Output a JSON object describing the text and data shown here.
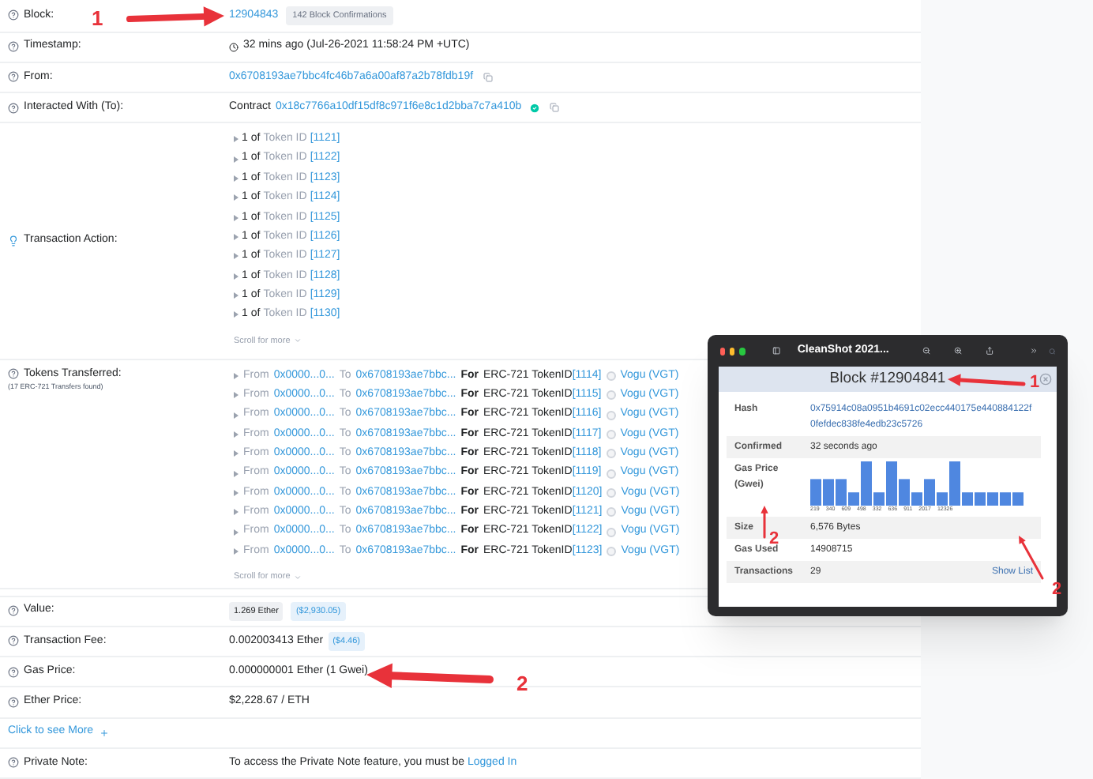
{
  "block": {
    "label": "Block:",
    "value": "12904843",
    "badge": "142 Block Confirmations"
  },
  "timestamp": {
    "label": "Timestamp:",
    "value": "32 mins ago (Jul-26-2021 11:58:24 PM +UTC)"
  },
  "from": {
    "label": "From:",
    "value": "0x6708193ae7bbc4fc46b7a6a00af87a2b78fdb19f"
  },
  "interacted_with": {
    "label": "Interacted With (To):",
    "prefix": "Contract",
    "value": "0x18c7766a10df15df8c971f6e8c1d2bba7c7a410b",
    "verified": true
  },
  "transaction_action": {
    "label": "Transaction Action:",
    "items": [
      {
        "text": "1 of",
        "token": "Token ID",
        "id": "[1121]"
      },
      {
        "text": "1 of",
        "token": "Token ID",
        "id": "[1122]"
      },
      {
        "text": "1 of",
        "token": "Token ID",
        "id": "[1123]"
      },
      {
        "text": "1 of",
        "token": "Token ID",
        "id": "[1124]"
      },
      {
        "text": "1 of",
        "token": "Token ID",
        "id": "[1125]"
      },
      {
        "text": "1 of",
        "token": "Token ID",
        "id": "[1126]"
      },
      {
        "text": "1 of",
        "token": "Token ID",
        "id": "[1127]"
      },
      {
        "text": "1 of",
        "token": "Token ID",
        "id": "[1128]"
      },
      {
        "text": "1 of",
        "token": "Token ID",
        "id": "[1129]"
      },
      {
        "text": "1 of",
        "token": "Token ID",
        "id": "[1130]"
      }
    ],
    "scroll_hint": "Scroll for more"
  },
  "tokens_transferred": {
    "label": "Tokens Transferred:",
    "sublabel": "(17 ERC-721 Transfers found)",
    "items": [
      {
        "from_label": "From",
        "from": "0x0000...0...",
        "to_label": "To",
        "to": "0x6708193ae7bbc...",
        "for_label": "For",
        "standard": "ERC-721 TokenID",
        "id": "[1114]",
        "token": "Vogu (VGT)"
      },
      {
        "from_label": "From",
        "from": "0x0000...0...",
        "to_label": "To",
        "to": "0x6708193ae7bbc...",
        "for_label": "For",
        "standard": "ERC-721 TokenID",
        "id": "[1115]",
        "token": "Vogu (VGT)"
      },
      {
        "from_label": "From",
        "from": "0x0000...0...",
        "to_label": "To",
        "to": "0x6708193ae7bbc...",
        "for_label": "For",
        "standard": "ERC-721 TokenID",
        "id": "[1116]",
        "token": "Vogu (VGT)"
      },
      {
        "from_label": "From",
        "from": "0x0000...0...",
        "to_label": "To",
        "to": "0x6708193ae7bbc...",
        "for_label": "For",
        "standard": "ERC-721 TokenID",
        "id": "[1117]",
        "token": "Vogu (VGT)"
      },
      {
        "from_label": "From",
        "from": "0x0000...0...",
        "to_label": "To",
        "to": "0x6708193ae7bbc...",
        "for_label": "For",
        "standard": "ERC-721 TokenID",
        "id": "[1118]",
        "token": "Vogu (VGT)"
      },
      {
        "from_label": "From",
        "from": "0x0000...0...",
        "to_label": "To",
        "to": "0x6708193ae7bbc...",
        "for_label": "For",
        "standard": "ERC-721 TokenID",
        "id": "[1119]",
        "token": "Vogu (VGT)"
      },
      {
        "from_label": "From",
        "from": "0x0000...0...",
        "to_label": "To",
        "to": "0x6708193ae7bbc...",
        "for_label": "For",
        "standard": "ERC-721 TokenID",
        "id": "[1120]",
        "token": "Vogu (VGT)"
      },
      {
        "from_label": "From",
        "from": "0x0000...0...",
        "to_label": "To",
        "to": "0x6708193ae7bbc...",
        "for_label": "For",
        "standard": "ERC-721 TokenID",
        "id": "[1121]",
        "token": "Vogu (VGT)"
      },
      {
        "from_label": "From",
        "from": "0x0000...0...",
        "to_label": "To",
        "to": "0x6708193ae7bbc...",
        "for_label": "For",
        "standard": "ERC-721 TokenID",
        "id": "[1122]",
        "token": "Vogu (VGT)"
      },
      {
        "from_label": "From",
        "from": "0x0000...0...",
        "to_label": "To",
        "to": "0x6708193ae7bbc...",
        "for_label": "For",
        "standard": "ERC-721 TokenID",
        "id": "[1123]",
        "token": "Vogu (VGT)"
      }
    ],
    "scroll_hint": "Scroll for more"
  },
  "value": {
    "label": "Value:",
    "amount": "1.269 Ether",
    "usd": "($2,930.05)"
  },
  "transaction_fee": {
    "label": "Transaction Fee:",
    "amount": "0.002003413 Ether",
    "usd": "($4.46)"
  },
  "gas_price": {
    "label": "Gas Price:",
    "value": "0.000000001 Ether (1 Gwei)"
  },
  "ether_price": {
    "label": "Ether Price:",
    "value": "$2,228.67 / ETH"
  },
  "see_more": "Click to see More",
  "private_note": {
    "label": "Private Note:",
    "text": "To access the Private Note feature, you must be",
    "link": "Logged In"
  },
  "popup": {
    "title": "CleanShot 2021...",
    "header": "Block #12904841",
    "rows": [
      {
        "kind": "link",
        "label": "Hash",
        "value": "0x75914c08a0951b4691c02ecc440175e440884122f0fefdec838fe4edb23c5726"
      },
      {
        "kind": "text",
        "label": "Confirmed",
        "value": "32 seconds ago"
      },
      {
        "kind": "chart",
        "label": "Gas Price (Gwei)",
        "axis_labels": [
          "219",
          "340",
          "609",
          "498",
          "332",
          "636",
          "911",
          "2017",
          "12326"
        ]
      },
      {
        "kind": "text",
        "label": "Size",
        "value": "6,576 Bytes"
      },
      {
        "kind": "text",
        "label": "Gas Used",
        "value": "14908715"
      },
      {
        "kind": "action",
        "label": "Transactions",
        "value": "29",
        "action": "Show List"
      }
    ]
  },
  "annotations": [
    {
      "label": "1"
    },
    {
      "label": "2"
    },
    {
      "label": "1"
    },
    {
      "label": "2"
    },
    {
      "label": "2"
    }
  ]
}
